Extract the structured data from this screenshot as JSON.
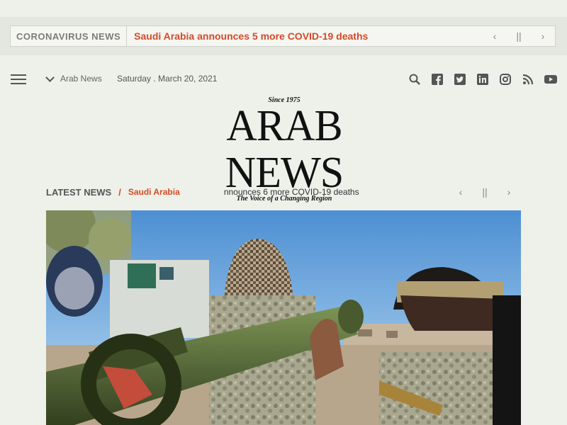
{
  "breaking": {
    "label": "CORONAVIRUS NEWS",
    "headline": "Saudi Arabia announces 5 more COVID-19 deaths",
    "prev_icon": "chevron-left-icon",
    "pause_icon": "pause-icon",
    "next_icon": "chevron-right-icon",
    "prev": "‹",
    "pause": "||",
    "next": "›"
  },
  "header": {
    "edition": "Arab News",
    "date": "Saturday .  March 20, 2021",
    "social": [
      "search-icon",
      "facebook-icon",
      "twitter-icon",
      "linkedin-icon",
      "instagram-icon",
      "rss-icon",
      "youtube-icon"
    ]
  },
  "logo": {
    "since": "Since 1975",
    "wordmark": "ARAB NEWS",
    "tagline": "The Voice of a Changing Region"
  },
  "latest": {
    "label": "LATEST NEWS",
    "separator": "/",
    "category": "Saudi Arabia",
    "headline": "nnounces 6 more COVID-19 deaths",
    "prev": "‹",
    "pause": "||",
    "next": "›"
  },
  "colors": {
    "accent": "#d44a26",
    "background": "#eef0ea"
  }
}
